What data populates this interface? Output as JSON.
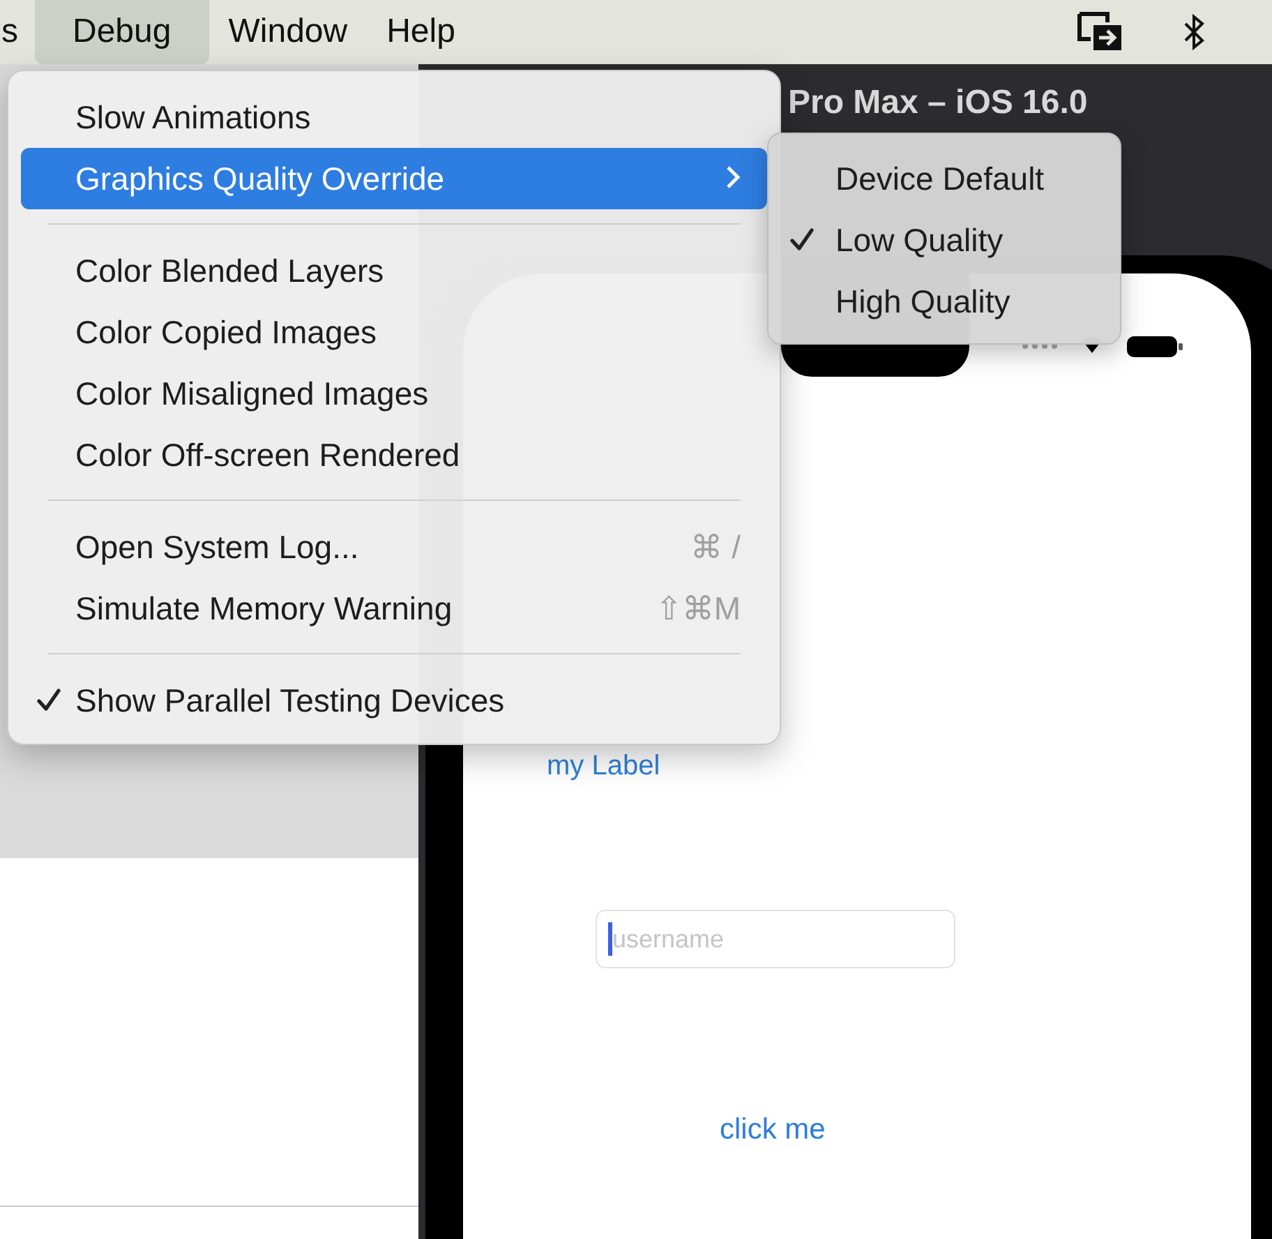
{
  "menubar": {
    "items": [
      {
        "label": "s",
        "selected": false
      },
      {
        "label": "Debug",
        "selected": true
      },
      {
        "label": "Window",
        "selected": false
      },
      {
        "label": "Help",
        "selected": false
      }
    ]
  },
  "simulator": {
    "title": "Pro Max – iOS 16.0",
    "label": "my Label",
    "field": {
      "placeholder": "username",
      "focused": true
    },
    "button": "click me"
  },
  "menu": {
    "items": [
      {
        "kind": "item",
        "label": "Slow Animations",
        "checked": false,
        "highlighted": false,
        "submenu": false
      },
      {
        "kind": "item",
        "label": "Graphics Quality Override",
        "checked": false,
        "highlighted": true,
        "submenu": true
      },
      {
        "kind": "separator"
      },
      {
        "kind": "item",
        "label": "Color Blended Layers",
        "checked": false,
        "highlighted": false,
        "submenu": false
      },
      {
        "kind": "item",
        "label": "Color Copied Images",
        "checked": false,
        "highlighted": false,
        "submenu": false
      },
      {
        "kind": "item",
        "label": "Color Misaligned Images",
        "checked": false,
        "highlighted": false,
        "submenu": false
      },
      {
        "kind": "item",
        "label": "Color Off-screen Rendered",
        "checked": false,
        "highlighted": false,
        "submenu": false
      },
      {
        "kind": "separator"
      },
      {
        "kind": "item",
        "label": "Open System Log...",
        "checked": false,
        "highlighted": false,
        "submenu": false,
        "shortcut": "⌘ /"
      },
      {
        "kind": "item",
        "label": "Simulate Memory Warning",
        "checked": false,
        "highlighted": false,
        "submenu": false,
        "shortcut": "⇧⌘M"
      },
      {
        "kind": "separator"
      },
      {
        "kind": "item",
        "label": "Show Parallel Testing Devices",
        "checked": true,
        "highlighted": false,
        "submenu": false
      }
    ]
  },
  "submenu": {
    "items": [
      {
        "label": "Device Default",
        "checked": false
      },
      {
        "label": "Low Quality",
        "checked": true
      },
      {
        "label": "High Quality",
        "checked": false
      }
    ]
  }
}
